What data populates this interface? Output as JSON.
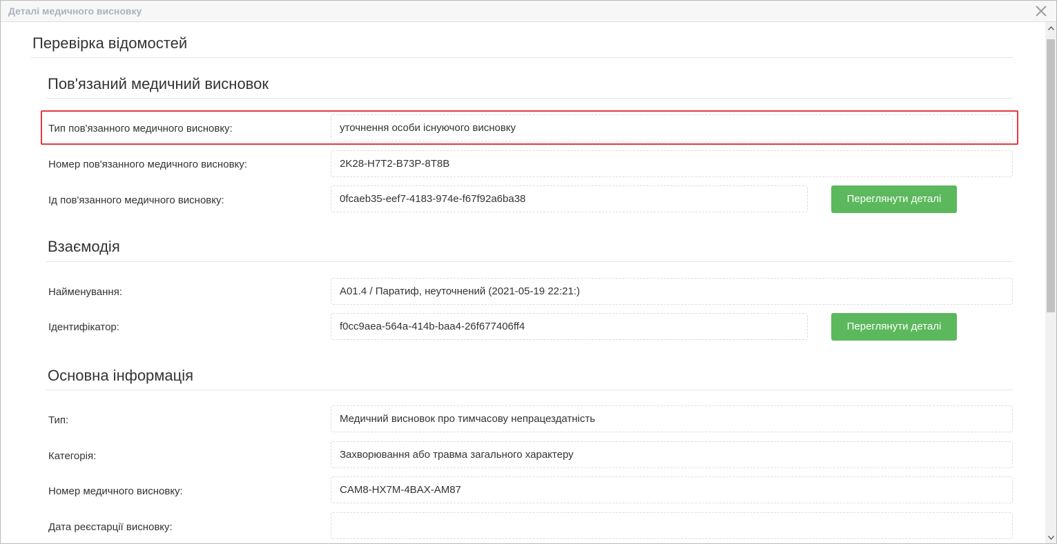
{
  "window": {
    "title": "Деталі медичного висновку"
  },
  "page": {
    "title": "Перевірка відомостей"
  },
  "related": {
    "title": "Пов'язаний медичний висновок",
    "type_label": "Тип пов'язанного медичного висновку:",
    "type_value": "уточнення особи існуючого висновку",
    "number_label": "Номер пов'язанного медичного висновку:",
    "number_value": "2K28-H7T2-B73P-8T8B",
    "id_label": "Ід пов'язанного медичного висновку:",
    "id_value": "0fcaeb35-eef7-4183-974e-f67f92a6ba38",
    "details_button": "Переглянути деталі"
  },
  "interaction": {
    "title": "Взаємодія",
    "name_label": "Найменування:",
    "name_value": "A01.4 / Паратиф, неуточнений (2021-05-19 22:21:)",
    "identifier_label": "Ідентифікатор:",
    "identifier_value": "f0cc9aea-564a-414b-baa4-26f677406ff4",
    "details_button": "Переглянути деталі"
  },
  "main_info": {
    "title": "Основна інформація",
    "type_label": "Тип:",
    "type_value": "Медичний висновок про тимчасову непрацездатність",
    "category_label": "Категорія:",
    "category_value": "Захворювання або травма загального характеру",
    "number_label": "Номер медичного висновку:",
    "number_value": "CAM8-HX7M-4BAX-AM87",
    "reg_date_label": "Дата реєстарції висновку:",
    "reg_date_value": ""
  },
  "colors": {
    "accent_green": "#5cb85c",
    "highlight_red": "#e0393e"
  },
  "icons": {
    "close": "close-icon",
    "scroll_up": "chevron-up-icon",
    "scroll_down": "chevron-down-icon"
  }
}
